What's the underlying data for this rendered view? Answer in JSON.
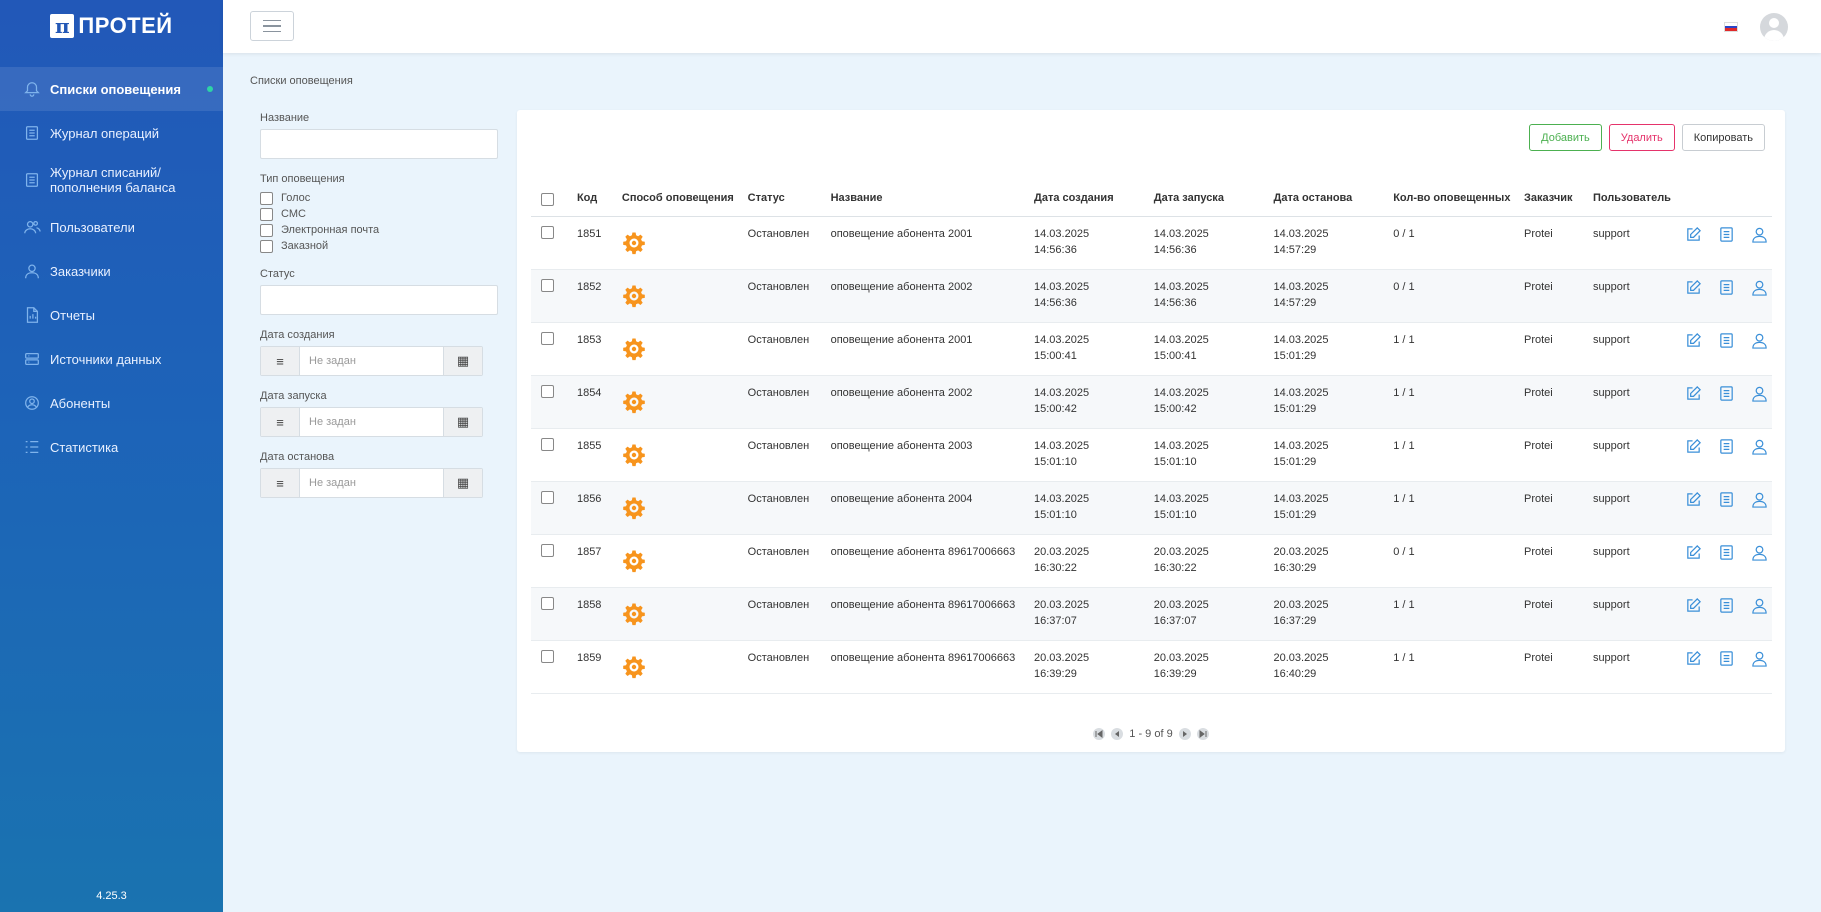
{
  "app": {
    "logo_text": "ПРОТЕЙ",
    "logo_mark": "π",
    "version": "4.25.3"
  },
  "sidebar": {
    "items": [
      {
        "label": "Списки оповещения",
        "icon": "bell-icon",
        "active": true
      },
      {
        "label": "Журнал операций",
        "icon": "journal-icon",
        "active": false
      },
      {
        "label": "Журнал списаний/ пополнения баланса",
        "icon": "journal-balance-icon",
        "active": false
      },
      {
        "label": "Пользователи",
        "icon": "users-icon",
        "active": false
      },
      {
        "label": "Заказчики",
        "icon": "customer-icon",
        "active": false
      },
      {
        "label": "Отчеты",
        "icon": "report-icon",
        "active": false
      },
      {
        "label": "Источники данных",
        "icon": "database-icon",
        "active": false
      },
      {
        "label": "Абоненты",
        "icon": "subscriber-icon",
        "active": false
      },
      {
        "label": "Статистика",
        "icon": "statistics-icon",
        "active": false
      }
    ]
  },
  "breadcrumb": "Списки оповещения",
  "filters": {
    "name_label": "Название",
    "name_value": "",
    "type_label": "Тип оповещения",
    "types": [
      "Голос",
      "СМС",
      "Электронная почта",
      "Заказной"
    ],
    "status_label": "Статус",
    "status_value": "",
    "created_label": "Дата создания",
    "started_label": "Дата запуска",
    "stopped_label": "Дата останова",
    "date_placeholder": "Не задан"
  },
  "actions": {
    "add": "Добавить",
    "delete": "Удалить",
    "copy": "Копировать"
  },
  "table": {
    "headers": {
      "code": "Код",
      "method": "Способ оповещения",
      "status": "Статус",
      "name": "Название",
      "created": "Дата создания",
      "started": "Дата запуска",
      "stopped": "Дата останова",
      "count": "Кол-во оповещенных",
      "customer": "Заказчик",
      "user": "Пользователь"
    },
    "rows": [
      {
        "code": "1851",
        "status": "Остановлен",
        "name": "оповещение абонента 2001",
        "created_d": "14.03.2025",
        "created_t": "14:56:36",
        "started_d": "14.03.2025",
        "started_t": "14:56:36",
        "stopped_d": "14.03.2025",
        "stopped_t": "14:57:29",
        "count": "0 / 1",
        "customer": "Protei",
        "user": "support"
      },
      {
        "code": "1852",
        "status": "Остановлен",
        "name": "оповещение абонента 2002",
        "created_d": "14.03.2025",
        "created_t": "14:56:36",
        "started_d": "14.03.2025",
        "started_t": "14:56:36",
        "stopped_d": "14.03.2025",
        "stopped_t": "14:57:29",
        "count": "0 / 1",
        "customer": "Protei",
        "user": "support"
      },
      {
        "code": "1853",
        "status": "Остановлен",
        "name": "оповещение абонента 2001",
        "created_d": "14.03.2025",
        "created_t": "15:00:41",
        "started_d": "14.03.2025",
        "started_t": "15:00:41",
        "stopped_d": "14.03.2025",
        "stopped_t": "15:01:29",
        "count": "1 / 1",
        "customer": "Protei",
        "user": "support"
      },
      {
        "code": "1854",
        "status": "Остановлен",
        "name": "оповещение абонента 2002",
        "created_d": "14.03.2025",
        "created_t": "15:00:42",
        "started_d": "14.03.2025",
        "started_t": "15:00:42",
        "stopped_d": "14.03.2025",
        "stopped_t": "15:01:29",
        "count": "1 / 1",
        "customer": "Protei",
        "user": "support"
      },
      {
        "code": "1855",
        "status": "Остановлен",
        "name": "оповещение абонента 2003",
        "created_d": "14.03.2025",
        "created_t": "15:01:10",
        "started_d": "14.03.2025",
        "started_t": "15:01:10",
        "stopped_d": "14.03.2025",
        "stopped_t": "15:01:29",
        "count": "1 / 1",
        "customer": "Protei",
        "user": "support"
      },
      {
        "code": "1856",
        "status": "Остановлен",
        "name": "оповещение абонента 2004",
        "created_d": "14.03.2025",
        "created_t": "15:01:10",
        "started_d": "14.03.2025",
        "started_t": "15:01:10",
        "stopped_d": "14.03.2025",
        "stopped_t": "15:01:29",
        "count": "1 / 1",
        "customer": "Protei",
        "user": "support"
      },
      {
        "code": "1857",
        "status": "Остановлен",
        "name": "оповещение абонента 89617006663",
        "created_d": "20.03.2025",
        "created_t": "16:30:22",
        "started_d": "20.03.2025",
        "started_t": "16:30:22",
        "stopped_d": "20.03.2025",
        "stopped_t": "16:30:29",
        "count": "0 / 1",
        "customer": "Protei",
        "user": "support"
      },
      {
        "code": "1858",
        "status": "Остановлен",
        "name": "оповещение абонента 89617006663",
        "created_d": "20.03.2025",
        "created_t": "16:37:07",
        "started_d": "20.03.2025",
        "started_t": "16:37:07",
        "stopped_d": "20.03.2025",
        "stopped_t": "16:37:29",
        "count": "1 / 1",
        "customer": "Protei",
        "user": "support"
      },
      {
        "code": "1859",
        "status": "Остановлен",
        "name": "оповещение абонента 89617006663",
        "created_d": "20.03.2025",
        "created_t": "16:39:29",
        "started_d": "20.03.2025",
        "started_t": "16:39:29",
        "stopped_d": "20.03.2025",
        "stopped_t": "16:40:29",
        "count": "1 / 1",
        "customer": "Protei",
        "user": "support"
      }
    ]
  },
  "pagination": {
    "text": "1 - 9 of 9"
  },
  "colors": {
    "sidebar_top": "#2258b8",
    "sidebar_bottom": "#1a73b0",
    "accent": "#3a8fd8",
    "gear": "#f7941d",
    "add": "#4cb050",
    "delete": "#e5336b",
    "active_dot": "#2ed3a5"
  }
}
